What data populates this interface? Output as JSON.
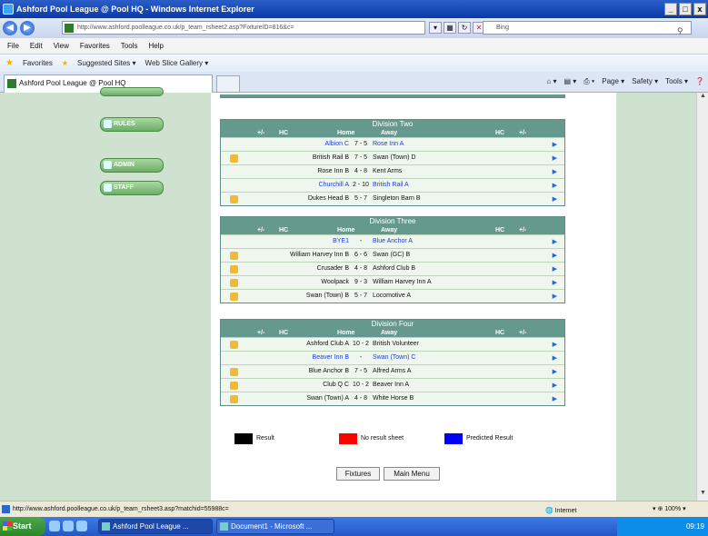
{
  "window": {
    "title": "Ashford Pool League @ Pool HQ - Windows Internet Explorer",
    "controls": [
      "_",
      "□",
      "x"
    ]
  },
  "address": {
    "url": "http://www.ashford.poolleague.co.uk/p_team_rsheet2.asp?FixtureID=816&c=",
    "search_placeholder": "Bing"
  },
  "menu": [
    "File",
    "Edit",
    "View",
    "Favorites",
    "Tools",
    "Help"
  ],
  "favorites_bar": {
    "favorites": "Favorites",
    "suggested": "Suggested Sites ▾",
    "webslice": "Web Slice Gallery ▾"
  },
  "tab": {
    "label": "Ashford Pool League @ Pool HQ"
  },
  "command_bar": [
    "Page ▾",
    "Safety ▾",
    "Tools ▾"
  ],
  "sidebar": {
    "buttons": [
      {
        "label": "RULES"
      },
      {
        "label": "ADMIN"
      },
      {
        "label": "STAFF"
      }
    ]
  },
  "table_headers": {
    "plusminus_left": "+/-",
    "hc_left": "HC",
    "home": "Home",
    "away": "Away",
    "hc_right": "HC",
    "plusminus_right": "+/-"
  },
  "divisions": [
    {
      "title": "Division Two",
      "matches": [
        {
          "lock": false,
          "predicted": true,
          "home": "Albion C",
          "score": "7 - 5",
          "away": "Rose Inn A"
        },
        {
          "lock": true,
          "predicted": false,
          "home": "British Rail B",
          "score": "7 - 5",
          "away": "Swan (Town) D"
        },
        {
          "lock": false,
          "predicted": false,
          "home": "Rose Inn B",
          "score": "4 - 8",
          "away": "Kent Arms"
        },
        {
          "lock": false,
          "predicted": true,
          "home": "Churchill A",
          "score": "2 - 10",
          "away": "British Rail A"
        },
        {
          "lock": true,
          "predicted": false,
          "home": "Dukes Head B",
          "score": "5 - 7",
          "away": "Singleton Barn B"
        }
      ]
    },
    {
      "title": "Division Three",
      "matches": [
        {
          "lock": false,
          "predicted": true,
          "home": "BYE1",
          "score": "-",
          "away": "Blue Anchor A"
        },
        {
          "lock": true,
          "predicted": false,
          "home": "William Harvey Inn B",
          "score": "6 - 6",
          "away": "Swan (GC) B"
        },
        {
          "lock": true,
          "predicted": false,
          "home": "Crusader B",
          "score": "4 - 8",
          "away": "Ashford Club B"
        },
        {
          "lock": true,
          "predicted": false,
          "home": "Woolpack",
          "score": "9 - 3",
          "away": "William Harvey Inn A"
        },
        {
          "lock": true,
          "predicted": false,
          "home": "Swan (Town) B",
          "score": "5 - 7",
          "away": "Locomotive A"
        }
      ]
    },
    {
      "title": "Division Four",
      "matches": [
        {
          "lock": true,
          "predicted": false,
          "home": "Ashford Club A",
          "score": "10 - 2",
          "away": "British Volunteer"
        },
        {
          "lock": false,
          "predicted": true,
          "home": "Beaver Inn B",
          "score": "-",
          "away": "Swan (Town) C"
        },
        {
          "lock": true,
          "predicted": false,
          "home": "Blue Anchor B",
          "score": "7 - 5",
          "away": "Alfred Arms A"
        },
        {
          "lock": true,
          "predicted": false,
          "home": "Club Q C",
          "score": "10 - 2",
          "away": "Beaver Inn A"
        },
        {
          "lock": true,
          "predicted": false,
          "home": "Swan (Town) A",
          "score": "4 - 8",
          "away": "White Horse B"
        }
      ]
    }
  ],
  "legend": [
    {
      "label": "Result",
      "color": "#000000"
    },
    {
      "label": "No result sheet",
      "color": "#ff0000"
    },
    {
      "label": "Predicted Result",
      "color": "#0000ff"
    }
  ],
  "buttons": {
    "fixtures": "Fixtures",
    "main_menu": "Main Menu"
  },
  "status": {
    "url": "http://www.ashford.poolleague.co.uk/p_team_rsheet3.asp?matchid=55988c=",
    "zone": "Internet",
    "zoom": "▾ ⊕ 100% ▾"
  },
  "taskbar": {
    "start": "Start",
    "items": [
      {
        "label": "Ashford Pool League ...",
        "active": true
      },
      {
        "label": "Document1 - Microsoft ...",
        "active": false
      }
    ],
    "clock": "09:19"
  },
  "colors": {
    "division_header": "#66998e",
    "row_background": "#eef6ee",
    "sidebar": "#cfe2cf",
    "predicted_text": "#1f3bd8"
  }
}
